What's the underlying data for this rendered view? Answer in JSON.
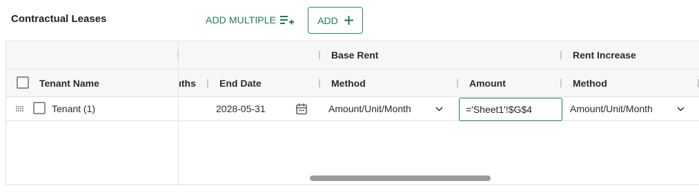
{
  "section": {
    "title": "Contractual Leases",
    "add_multiple_label": "ADD MULTIPLE",
    "add_label": "ADD"
  },
  "grid": {
    "group_headers": {
      "base_rent": "Base Rent",
      "rent_increase": "Rent Increase"
    },
    "columns": {
      "tenant_name": "Tenant Name",
      "months_partial": "ıths",
      "end_date": "End Date",
      "base_method": "Method",
      "amount": "Amount",
      "increase_method": "Method"
    },
    "rows": [
      {
        "tenant": "Tenant (1)",
        "end_date": "2028-05-31",
        "base_method": "Amount/Unit/Month",
        "amount_edit_value": "='Sheet1'!$G$4",
        "increase_method": "Amount/Unit/Month"
      }
    ]
  },
  "colors": {
    "accent": "#1b7a57",
    "header_bg": "#f7f7f7",
    "border": "#e2e2e2"
  }
}
